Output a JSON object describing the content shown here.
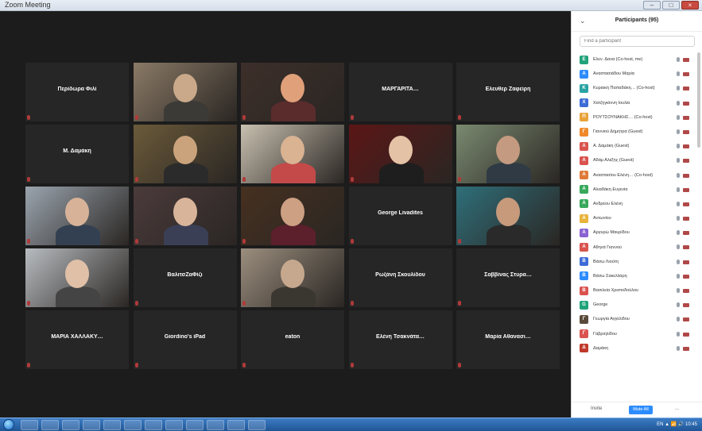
{
  "window": {
    "title": "Zoom Meeting",
    "controls": [
      "–",
      "□",
      "×"
    ]
  },
  "gallery": {
    "tiles": [
      {
        "label": "Περίδωρα Φιλί",
        "corner": "",
        "video": false
      },
      {
        "label": "",
        "corner": "",
        "video": true
      },
      {
        "label": "",
        "corner": "",
        "video": true
      },
      {
        "label": "ΜΑΡΓΑΡΙΤΑ…",
        "corner": "",
        "video": false
      },
      {
        "label": "Ελευθερ Ζαφείρη",
        "corner": "",
        "video": false
      },
      {
        "label": "Μ. Δαμάκη",
        "corner": "",
        "video": false
      },
      {
        "label": "",
        "corner": "",
        "video": true
      },
      {
        "label": "",
        "corner": "",
        "video": true
      },
      {
        "label": "",
        "corner": "",
        "video": true
      },
      {
        "label": "",
        "corner": "",
        "video": true
      },
      {
        "label": "",
        "corner": "",
        "video": true
      },
      {
        "label": "",
        "corner": "",
        "video": true
      },
      {
        "label": "",
        "corner": "",
        "video": true
      },
      {
        "label": "George Livadites",
        "corner": "",
        "video": false
      },
      {
        "label": "",
        "corner": "",
        "video": true
      },
      {
        "label": "",
        "corner": "",
        "video": true
      },
      {
        "label": "ΒαλιτσΖαΦίζι",
        "corner": "",
        "video": false
      },
      {
        "label": "",
        "corner": "",
        "video": true
      },
      {
        "label": "Ρωξάνη Σκουλίδου",
        "corner": "",
        "video": false
      },
      {
        "label": "Σαββίνας Στυρα…",
        "corner": "",
        "video": false
      },
      {
        "label": "ΜΑΡΙΑ ΧΑΛΛΑΚΥ…",
        "corner": "",
        "video": false
      },
      {
        "label": "Giordino's iPad",
        "corner": "",
        "video": false
      },
      {
        "label": "eaton",
        "corner": "",
        "video": false
      },
      {
        "label": "Ελένη Τσακνάτα…",
        "corner": "",
        "video": false
      },
      {
        "label": "Μαρία Αθανασι…",
        "corner": "",
        "video": false
      }
    ]
  },
  "participants": {
    "title": "Participants (95)",
    "search_placeholder": "Find a participant",
    "items": [
      {
        "initial": "Ε",
        "color": "#21a37a",
        "name": "Ελεν. Δανα (Co-host, me)"
      },
      {
        "initial": "Α",
        "color": "#2d8cff",
        "name": "Αναστασιάδου Μαρία"
      },
      {
        "initial": "Κ",
        "color": "#2aa3a3",
        "name": "Κυριακή Παπαδάκη… (Co-host)"
      },
      {
        "initial": "Χ",
        "color": "#3d6bd6",
        "name": "Χατζηγιάννη Ιουλία"
      },
      {
        "initial": "Π",
        "color": "#e8a23a",
        "name": "ΡΟΥΤΣΟΥΝΑΚΗΣ… (Co-host)"
      },
      {
        "initial": "Γ",
        "color": "#ef8a2b",
        "name": "Γιαννιού Δήμητρα (Guest)"
      },
      {
        "initial": "Α",
        "color": "#d9534f",
        "name": "Α. Δαμάκη (Guest)"
      },
      {
        "initial": "Α",
        "color": "#d9534f",
        "name": "Αδάμ Αλέξης (Guest)"
      },
      {
        "initial": "Α",
        "color": "#e07b39",
        "name": "Αναστασίου Ελένη… (Co-host)"
      },
      {
        "initial": "Α",
        "color": "#38a85b",
        "name": "Αλιαδάκη Ευγενία"
      },
      {
        "initial": "Α",
        "color": "#38a85b",
        "name": "Ανδρέου Ελένη"
      },
      {
        "initial": "Α",
        "color": "#e8b33a",
        "name": "Αντωνίου"
      },
      {
        "initial": "Α",
        "color": "#8a63d2",
        "name": "Αργυρώ Μαυρίδου"
      },
      {
        "initial": "Α",
        "color": "#d9534f",
        "name": "Αθηνά Γιαννού"
      },
      {
        "initial": "Β",
        "color": "#3d6bd6",
        "name": "Βάσω Λιούτη"
      },
      {
        "initial": "Β",
        "color": "#2d8cff",
        "name": "Βάσω Σακελλάρη"
      },
      {
        "initial": "Β",
        "color": "#d9534f",
        "name": "Βασιλεία Χριστοδούλου"
      },
      {
        "initial": "G",
        "color": "#21a37a",
        "name": "George"
      },
      {
        "initial": "Γ",
        "color": "#5a4a3a",
        "name": "Γεωργία Αγγελίδου"
      },
      {
        "initial": "Γ",
        "color": "#d9534f",
        "name": "Γαβριηλίδου"
      },
      {
        "initial": "Δ",
        "color": "#c0392b",
        "name": "Δαμάκη"
      }
    ],
    "footer": {
      "invite": "Invite",
      "mute_all": "Mute All",
      "more": "..."
    }
  },
  "taskbar": {
    "tray_text": "EN ▲ 📶 🔊  10:45"
  }
}
